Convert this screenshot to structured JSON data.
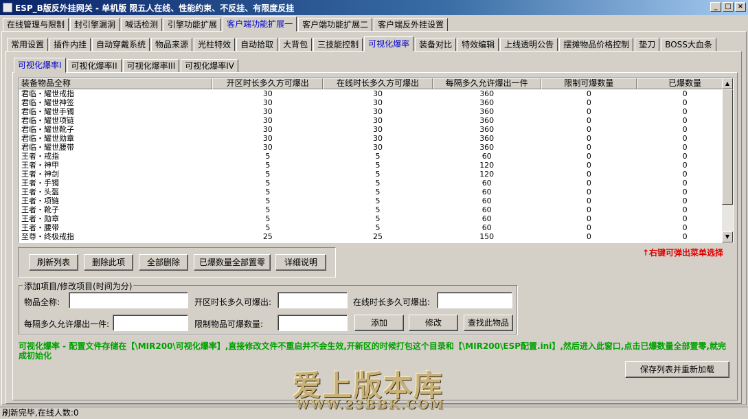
{
  "window": {
    "title": "ESP_B版反外挂网关 - 单机版 限五人在线、性能约束、不反挂、有限度反挂",
    "buttons": [
      "_",
      "□",
      "×"
    ]
  },
  "tabs_level1": [
    "在线管理与限制",
    "封引擎漏洞",
    "喊话检测",
    "引擎功能扩展",
    "客户端功能扩展一",
    "客户端功能扩展二",
    "客户端反外挂设置"
  ],
  "tabs_level1_active": 4,
  "tabs_level2": [
    "常用设置",
    "插件内挂",
    "自动穿戴系统",
    "物品来源",
    "光柱特效",
    "自动拾取",
    "大背包",
    "三技能控制",
    "可视化爆率",
    "装备对比",
    "特效编辑",
    "上线透明公告",
    "摆摊物品价格控制",
    "垫刀",
    "BOSS大血条"
  ],
  "tabs_level2_active": 8,
  "tabs_level3": [
    "可视化爆率I",
    "可视化爆率II",
    "可视化爆率III",
    "可视化爆率IV"
  ],
  "tabs_level3_active": 0,
  "grid": {
    "headers": [
      "装备物品全称",
      "开区时长多久方可爆出",
      "在线时长多久方可爆出",
      "每隔多久允许爆出一件",
      "限制可爆数量",
      "已爆数量"
    ],
    "rows": [
      [
        "君临・耀世戒指",
        "30",
        "30",
        "360",
        "0",
        "0"
      ],
      [
        "君临・耀世神签",
        "30",
        "30",
        "360",
        "0",
        "0"
      ],
      [
        "君临・耀世手镯",
        "30",
        "30",
        "360",
        "0",
        "0"
      ],
      [
        "君临・耀世项链",
        "30",
        "30",
        "360",
        "0",
        "0"
      ],
      [
        "君临・耀世靴子",
        "30",
        "30",
        "360",
        "0",
        "0"
      ],
      [
        "君临・耀世勋章",
        "30",
        "30",
        "360",
        "0",
        "0"
      ],
      [
        "君临・耀世腰带",
        "30",
        "30",
        "360",
        "0",
        "0"
      ],
      [
        "王者・戒指",
        "5",
        "5",
        "60",
        "0",
        "0"
      ],
      [
        "王者・神甲",
        "5",
        "5",
        "120",
        "0",
        "0"
      ],
      [
        "王者・神剑",
        "5",
        "5",
        "120",
        "0",
        "0"
      ],
      [
        "王者・手镯",
        "5",
        "5",
        "60",
        "0",
        "0"
      ],
      [
        "王者・头盔",
        "5",
        "5",
        "60",
        "0",
        "0"
      ],
      [
        "王者・项链",
        "5",
        "5",
        "60",
        "0",
        "0"
      ],
      [
        "王者・靴子",
        "5",
        "5",
        "60",
        "0",
        "0"
      ],
      [
        "王者・勋章",
        "5",
        "5",
        "60",
        "0",
        "0"
      ],
      [
        "王者・腰带",
        "5",
        "5",
        "60",
        "0",
        "0"
      ],
      [
        "至尊・终极戒指",
        "25",
        "25",
        "150",
        "0",
        "0"
      ]
    ]
  },
  "actions": {
    "refresh": "刷新列表",
    "delete": "删除此项",
    "delete_all": "全部删除",
    "reset_dropped": "已爆数量全部置零",
    "details": "详细说明"
  },
  "hint_right_click": "↑右键可弹出菜单选择",
  "form": {
    "group_title": "添加项目/修改项目(时间为分)",
    "item_name_label": "物品全称:",
    "open_time_label": "开区时长多久可爆出:",
    "online_time_label": "在线时长多久可爆出:",
    "interval_label": "每隔多久允许爆出一件:",
    "limit_label": "限制物品可爆数量:",
    "add_button": "添加",
    "modify_button": "修改",
    "find_button": "查找此物品",
    "item_name_value": "",
    "open_time_value": "",
    "online_time_value": "",
    "interval_value": "",
    "limit_value": ""
  },
  "note": "可视化爆率 - 配置文件存储在【\\MIR200\\可视化爆率】,直接修改文件不重启并不会生效,开新区的时候打包这个目录和【\\MIR200\\ESP配置.ini】,然后进入此窗口,点击已爆数量全部置零,就完成初始化",
  "save_reload_button": "保存列表并重新加载",
  "watermark": "爱上版本库",
  "watermark_url": "WWW.23BBK.COM",
  "status": "刷新完毕,在线人数:0",
  "colors": {
    "title_bar": "#0a246a",
    "active_tab": "#0000cc",
    "hint": "#e00000",
    "note": "#00a000"
  }
}
